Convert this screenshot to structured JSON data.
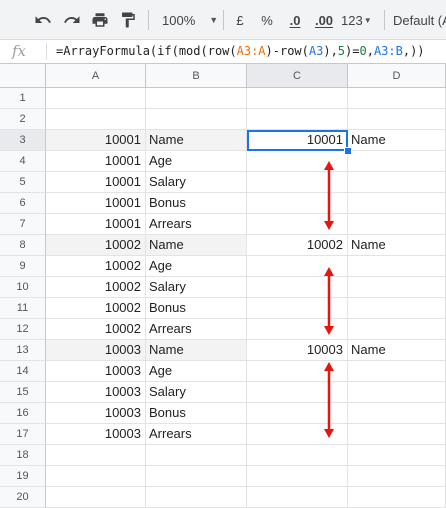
{
  "toolbar": {
    "undo_icon": "undo-icon",
    "redo_icon": "redo-icon",
    "print_icon": "print-icon",
    "paint_format_icon": "paint-format-icon",
    "zoom": "100%",
    "currency": "£",
    "percent": "%",
    "decrease_decimals": ".0",
    "increase_decimals": ".00",
    "more_formats": "123",
    "font": "Default (A"
  },
  "formula_bar": {
    "fx_label": "fx",
    "formula": "=ArrayFormula(if(mod(row(A3:A)-row(A3),5)=0,A3:B,))"
  },
  "columns": [
    "A",
    "B",
    "C",
    "D"
  ],
  "rows": [
    {
      "n": "1",
      "a": "",
      "b": "",
      "c": "",
      "d": ""
    },
    {
      "n": "2",
      "a": "",
      "b": "",
      "c": "",
      "d": ""
    },
    {
      "n": "3",
      "a": "10001",
      "b": "Name",
      "c": "10001",
      "d": "Name"
    },
    {
      "n": "4",
      "a": "10001",
      "b": "Age",
      "c": "",
      "d": ""
    },
    {
      "n": "5",
      "a": "10001",
      "b": "Salary",
      "c": "",
      "d": ""
    },
    {
      "n": "6",
      "a": "10001",
      "b": "Bonus",
      "c": "",
      "d": ""
    },
    {
      "n": "7",
      "a": "10001",
      "b": "Arrears",
      "c": "",
      "d": ""
    },
    {
      "n": "8",
      "a": "10002",
      "b": "Name",
      "c": "10002",
      "d": "Name"
    },
    {
      "n": "9",
      "a": "10002",
      "b": "Age",
      "c": "",
      "d": ""
    },
    {
      "n": "10",
      "a": "10002",
      "b": "Salary",
      "c": "",
      "d": ""
    },
    {
      "n": "11",
      "a": "10002",
      "b": "Bonus",
      "c": "",
      "d": ""
    },
    {
      "n": "12",
      "a": "10002",
      "b": "Arrears",
      "c": "",
      "d": ""
    },
    {
      "n": "13",
      "a": "10003",
      "b": "Name",
      "c": "10003",
      "d": "Name"
    },
    {
      "n": "14",
      "a": "10003",
      "b": "Age",
      "c": "",
      "d": ""
    },
    {
      "n": "15",
      "a": "10003",
      "b": "Salary",
      "c": "",
      "d": ""
    },
    {
      "n": "16",
      "a": "10003",
      "b": "Bonus",
      "c": "",
      "d": ""
    },
    {
      "n": "17",
      "a": "10003",
      "b": "Arrears",
      "c": "",
      "d": ""
    },
    {
      "n": "18",
      "a": "",
      "b": "",
      "c": "",
      "d": ""
    },
    {
      "n": "19",
      "a": "",
      "b": "",
      "c": "",
      "d": ""
    },
    {
      "n": "20",
      "a": "",
      "b": "",
      "c": "",
      "d": ""
    }
  ],
  "selection": {
    "active_cell": "C3"
  },
  "annotation": {
    "arrow_color": "#e8140e"
  },
  "colors": {
    "selection": "#1a73e8",
    "band": "#f3f3f3"
  }
}
